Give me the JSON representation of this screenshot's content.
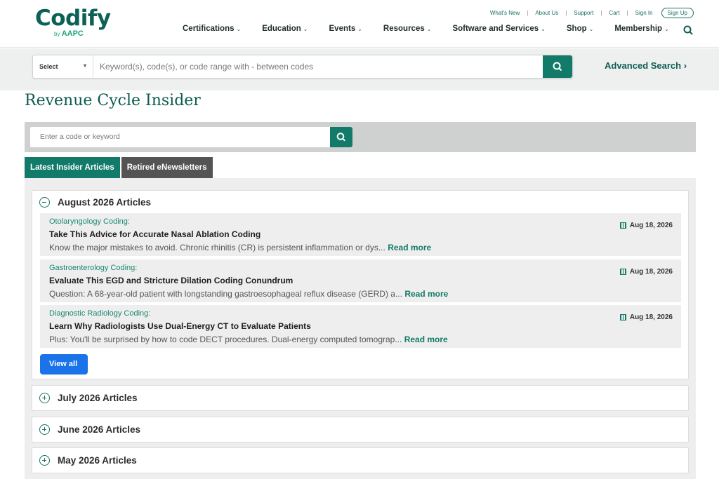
{
  "header": {
    "logo_text": "Codify",
    "logo_by": "by",
    "logo_brand": "AAPC",
    "util_links": [
      "What's New",
      "About Us",
      "Support",
      "Cart",
      "Sign In"
    ],
    "signup": "Sign Up",
    "nav": [
      "Certifications",
      "Education",
      "Events",
      "Resources",
      "Software and Services",
      "Shop",
      "Membership"
    ]
  },
  "search": {
    "select_label": "Select",
    "placeholder": "Keyword(s), code(s), or code range with - between codes",
    "advanced": "Advanced Search ›"
  },
  "page": {
    "title": "Revenue Cycle Insider",
    "filter_placeholder": "Enter a code or keyword",
    "tabs": [
      "Latest Insider Articles",
      "Retired eNewsletters"
    ]
  },
  "sections": {
    "open": {
      "label": "August 2026 Articles",
      "articles": [
        {
          "category": "Otolaryngology Coding:",
          "title": "Take This Advice for Accurate Nasal Ablation Coding",
          "excerpt": "Know the major mistakes to avoid. Chronic rhinitis (CR) is persistent inflammation or dys...",
          "read_more": "Read more",
          "date": "Aug 18, 2026"
        },
        {
          "category": "Gastroenterology Coding:",
          "title": "Evaluate This EGD and Stricture Dilation Coding Conundrum",
          "excerpt": "Question: A 68-year-old patient with longstanding gastroesophageal reflux disease (GERD) a...",
          "read_more": "Read more",
          "date": "Aug 18, 2026"
        },
        {
          "category": "Diagnostic Radiology Coding:",
          "title": "Learn Why Radiologists Use Dual-Energy CT to Evaluate Patients",
          "excerpt": "Plus: You'll be surprised by how to code DECT procedures. Dual-energy computed tomograp...",
          "read_more": "Read more",
          "date": "Aug 18, 2026"
        }
      ],
      "view_all": "View all"
    },
    "collapsed": [
      "July 2026 Articles",
      "June 2026 Articles",
      "May 2026 Articles"
    ]
  },
  "colors": {
    "brand": "#127a68",
    "view_all": "#1a73e8"
  }
}
